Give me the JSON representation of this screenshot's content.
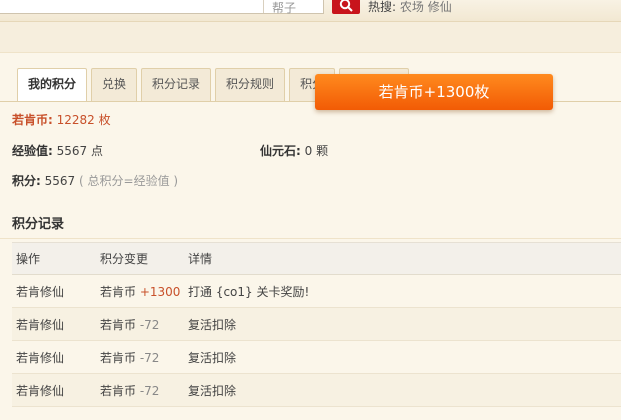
{
  "top": {
    "search_hint": "帮子",
    "hot_label": "热搜:",
    "hot_links": "农场  修仙"
  },
  "tabs": [
    {
      "label": "我的积分",
      "active": true
    },
    {
      "label": "兑换"
    },
    {
      "label": "积分记录"
    },
    {
      "label": "积分规则"
    },
    {
      "label": "积分"
    },
    {
      "label": ""
    }
  ],
  "toast": "若肯币+1300枚",
  "stats": {
    "coin_label": "若肯币:",
    "coin_value": "12282 枚",
    "exp_label": "经验值:",
    "exp_value": "5567 点",
    "stone_label": "仙元石:",
    "stone_value": "0 颗",
    "points_label": "积分:",
    "points_value": "5567",
    "points_note": "( 总积分=经验值 )"
  },
  "records": {
    "title": "积分记录",
    "headers": [
      "操作",
      "积分变更",
      "详情"
    ],
    "rows": [
      {
        "op": "若肯修仙",
        "unit": "若肯币",
        "delta": "+1300",
        "detail": "打通 {co1} 关卡奖励!"
      },
      {
        "op": "若肯修仙",
        "unit": "若肯币",
        "delta": "-72",
        "detail": "复活扣除"
      },
      {
        "op": "若肯修仙",
        "unit": "若肯币",
        "delta": "-72",
        "detail": "复活扣除"
      },
      {
        "op": "若肯修仙",
        "unit": "若肯币",
        "delta": "-72",
        "detail": "复活扣除"
      }
    ]
  }
}
